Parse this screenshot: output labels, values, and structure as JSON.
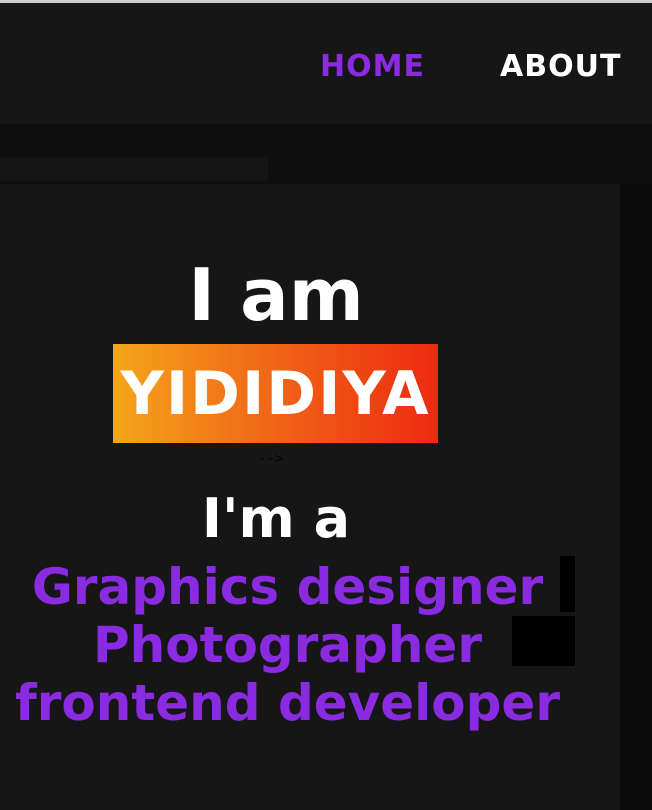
{
  "nav": {
    "home_label": "HOME",
    "about_label": "ABOUT"
  },
  "hero": {
    "intro": "I am",
    "name": "YIDIDIYA",
    "comment_artifact": "-->",
    "role_intro": "I'm a",
    "roles": [
      "Graphics designer",
      "Photographer",
      "frontend developer"
    ]
  },
  "colors": {
    "accent": "#8a2be2",
    "name_gradient_start": "#f5a51a",
    "name_gradient_end": "#ee2a10",
    "background": "#161616"
  }
}
